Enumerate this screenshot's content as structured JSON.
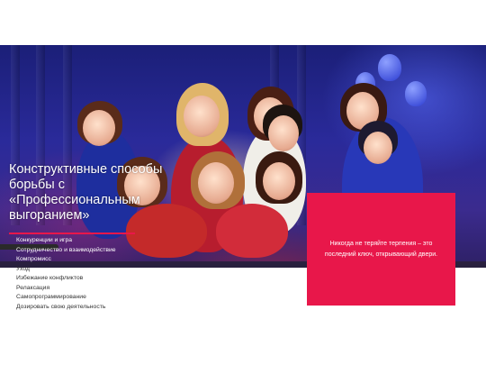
{
  "slide": {
    "headline": "Конструктивные способы борьбы с «Профессиональным выгоранием»",
    "methods": [
      "Конкуренции и игра",
      "Сотрудничество и взаимодействие",
      "Компромисс",
      "Уход",
      "Избежание конфликтов",
      "Релаксация",
      "Самопрограммирование",
      "Дозировать свою деятельность"
    ],
    "quote": "Никогда не теряйте терпения – это последний ключ, открывающий двери."
  },
  "colors": {
    "accent": "#e8174a",
    "photo_background": "#2a2a9a",
    "text_on_white": "#333333"
  }
}
